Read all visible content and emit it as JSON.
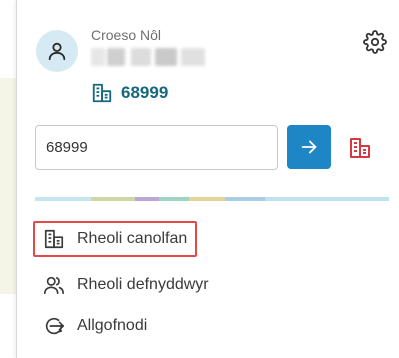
{
  "user": {
    "welcome_text": "Croeso Nôl",
    "avatar_icon": "user-icon"
  },
  "header": {
    "settings_icon": "gear-icon"
  },
  "centre": {
    "number": "68999",
    "icon": "building-icon"
  },
  "search": {
    "value": "68999",
    "submit_icon": "arrow-right-icon",
    "centre_icon": "building-icon"
  },
  "menu": {
    "items": [
      {
        "label": "Rheoli canolfan",
        "icon": "building-icon",
        "highlighted": true
      },
      {
        "label": "Rheoli defnyddwyr",
        "icon": "users-icon",
        "highlighted": false
      },
      {
        "label": "Allgofnodi",
        "icon": "logout-icon",
        "highlighted": false
      }
    ]
  },
  "colors": {
    "accent": "#1f86c6",
    "centre_text": "#15687d",
    "highlight_border": "#e24a4a",
    "centre_icon_red": "#d9383f",
    "avatar_bg": "#d6eaf3"
  }
}
